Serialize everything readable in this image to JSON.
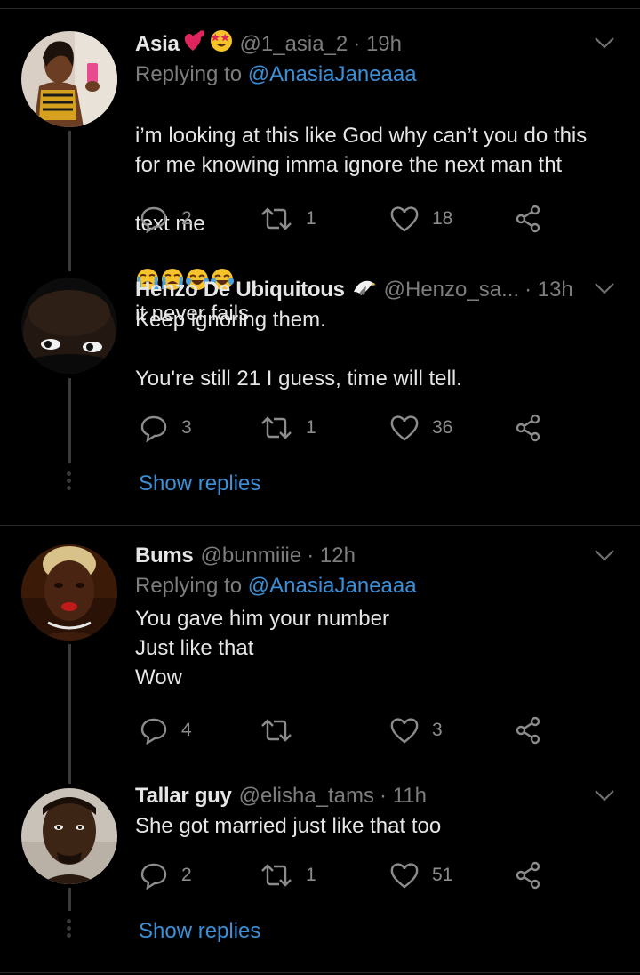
{
  "tweets": [
    {
      "name": "Asia",
      "handle": "@1_asia_2",
      "time": "· 19h",
      "replying_to_prefix": "Replying to",
      "replying_to_handle": "@AnasiaJaneaaa",
      "text": "i’m looking at this like God why can’t you do this\nfor me knowing imma ignore the next man tht",
      "text_last_start": "text me",
      "text_last_end": "it never fails",
      "replies": "2",
      "retweets": "1",
      "likes": "18"
    },
    {
      "name": "Henzo De Ubiquitous",
      "handle": "@Henzo_sa...",
      "time": "· 13h",
      "text": "Keep ignoring them.\n\nYou're still 21 I guess, time will tell.",
      "replies": "3",
      "retweets": "1",
      "likes": "36",
      "show_replies": "Show replies"
    },
    {
      "name": "Bums",
      "handle": "@bunmiiie",
      "time": "· 12h",
      "replying_to_prefix": "Replying to",
      "replying_to_handle": "@AnasiaJaneaaa",
      "text": "You gave him your number\nJust like that\nWow",
      "replies": "4",
      "retweets": "",
      "likes": "3"
    },
    {
      "name": "Tallar guy",
      "handle": "@elisha_tams",
      "time": "· 11h",
      "text": "She got married just like that too",
      "replies": "2",
      "retweets": "1",
      "likes": "51",
      "show_replies": "Show replies"
    }
  ],
  "colors": {
    "background": "#000000",
    "text": "#e6e6e6",
    "secondary": "#7d7d7d",
    "link": "#3b8fd6"
  },
  "icons": [
    "reply-icon",
    "retweet-icon",
    "like-icon",
    "share-icon",
    "chevron-down-icon",
    "eagle-icon",
    "heart-emoji",
    "star-struck-emoji",
    "crying-emoji",
    "tears-of-joy-emoji"
  ]
}
